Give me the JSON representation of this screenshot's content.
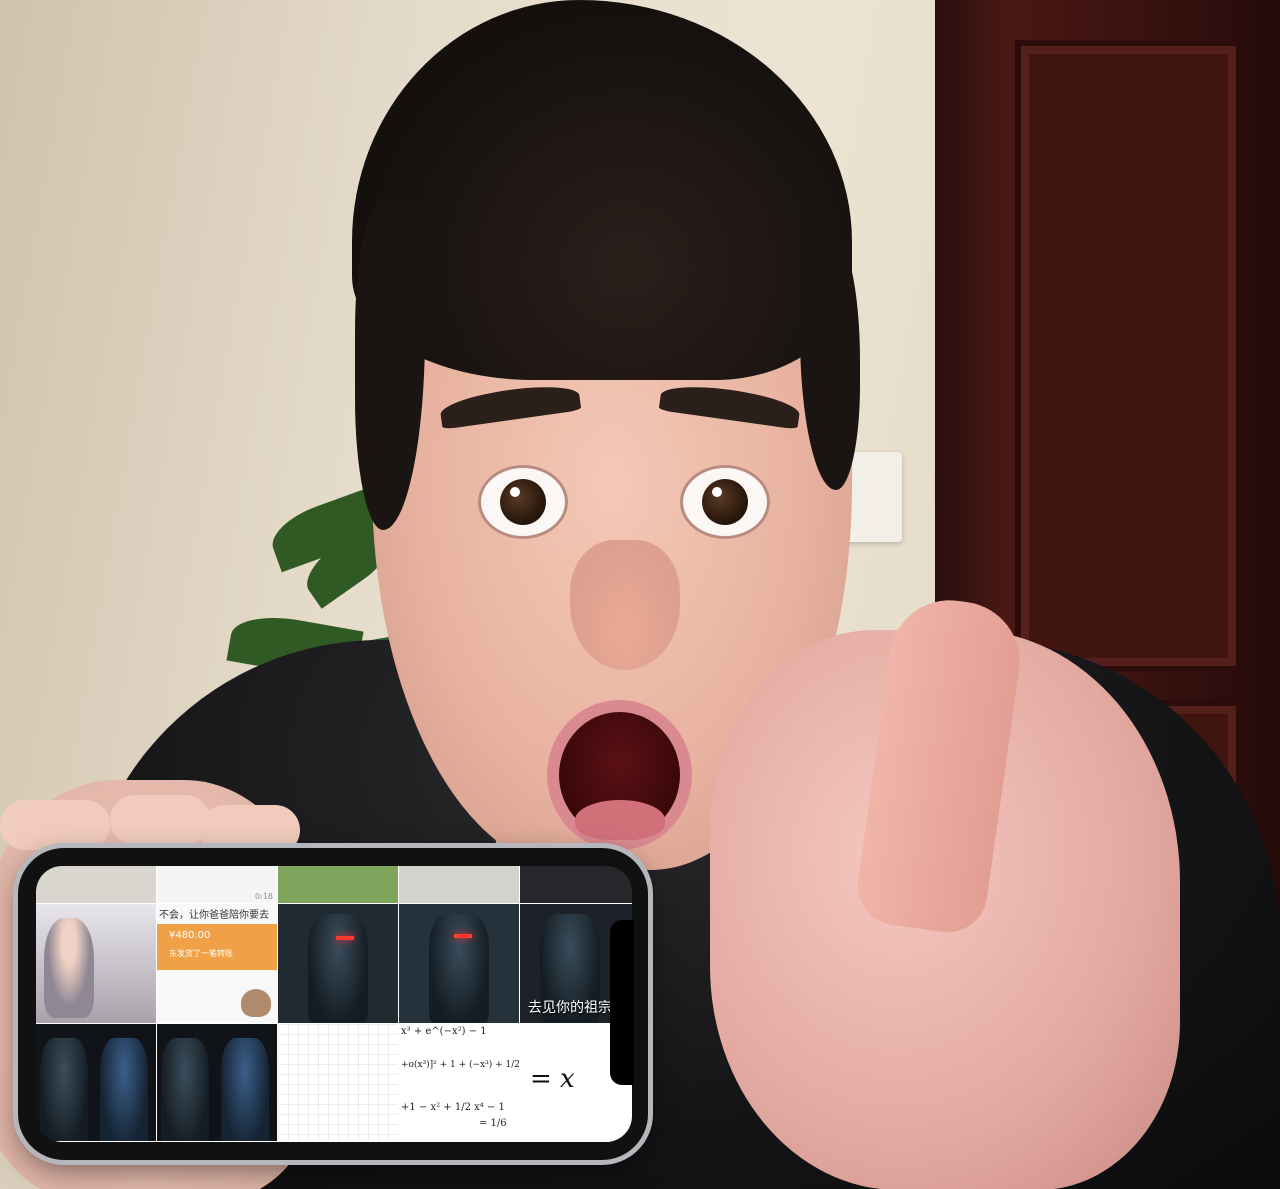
{
  "photo": {
    "subject": "man-thumbs-up-holding-phone"
  },
  "phone_screen": {
    "chat_text": "不会，让你爸爸陪你要去",
    "chat_time": "0:18",
    "payment_amount": "¥480.00",
    "payment_note": "东发货了一笔转账",
    "video_caption": "去见你的祖宗",
    "math_lines": [
      "x³ + e^(−x²) − 1",
      "+o(x³)]² + 1 + (−x³) + 1/2",
      "+1 − x² + 1/2 x⁴ − 1",
      "= 1/6"
    ],
    "big_math": "= x"
  },
  "colors": {
    "wall": "#e6dccb",
    "door": "#3a1210",
    "jacket": "#141416",
    "payment_orange": "#f0a046",
    "laser_red": "#ff3b30"
  }
}
